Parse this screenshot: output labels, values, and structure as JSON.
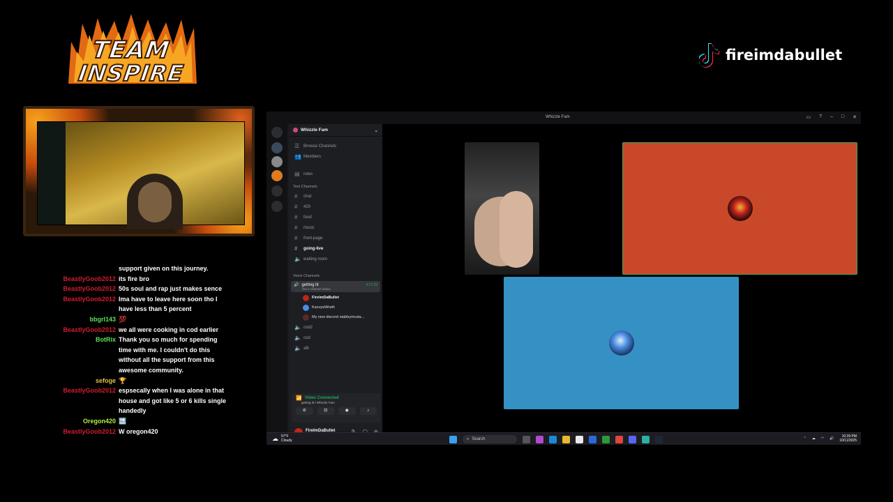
{
  "overlay": {
    "logo_line1": "TEAM",
    "logo_line2": "INSPIRE",
    "tiktok_handle": "fireimdabullet"
  },
  "chat": [
    {
      "user": "",
      "text": "support given on this journey.",
      "color": ""
    },
    {
      "user": "BeastlyGoob2012",
      "text": "its fire bro",
      "color": "red"
    },
    {
      "user": "BeastlyGoob2012",
      "text": "50s soul and rap just makes sence",
      "color": "red"
    },
    {
      "user": "BeastlyGoob2012",
      "text": "Ima have to leave here soon tho I have less than 5 percent",
      "color": "red"
    },
    {
      "user": "bbgrl143",
      "text": "💯",
      "color": "green"
    },
    {
      "user": "BeastlyGoob2012",
      "text": "we all were cooking in cod earlier",
      "color": "red"
    },
    {
      "user": "BotRix",
      "text": "Thank you so much for spending time with me. I couldn't do this without all the support from this awesome community.",
      "color": "green"
    },
    {
      "user": "sefoge",
      "text": "🏆",
      "color": "yellow"
    },
    {
      "user": "BeastlyGoob2012",
      "text": "espsecally when I was alone in that house and got like 5 or 6 kills single handedly",
      "color": "red"
    },
    {
      "user": "Oregon420",
      "text": "🔜",
      "color": "lime"
    },
    {
      "user": "BeastlyGoob2012",
      "text": "W oregon420",
      "color": "red"
    }
  ],
  "discord": {
    "window_title": "Whizzle Fam",
    "server_name": "Whizzle Fam",
    "top_items": [
      "Browse Channels",
      "Members"
    ],
    "rules": "rules",
    "text_category": "Text Channels",
    "text_channels": [
      "chat",
      "420",
      "food",
      "music",
      "front-page",
      "going-live",
      "waiting room"
    ],
    "voice_category": "Voice Channels",
    "voice_active": {
      "name": "getting lit",
      "status": "Set a channel status",
      "time": "4:17:28"
    },
    "voice_users": [
      "FireImDaBullet",
      "KazuyaWrath",
      "My new discord stabbymcsta..."
    ],
    "other_voice": [
      "cod2",
      "cod",
      "afk"
    ],
    "connection": {
      "status": "Video Connected",
      "location": "getting lit / Whizzle Fam"
    },
    "user": {
      "name": "FireImDaBullet",
      "status": "In voice"
    }
  },
  "taskbar": {
    "temp": "57°F",
    "weather": "Cloudy",
    "search": "Search",
    "time": "10:39 PM",
    "date": "10/11/2025"
  }
}
